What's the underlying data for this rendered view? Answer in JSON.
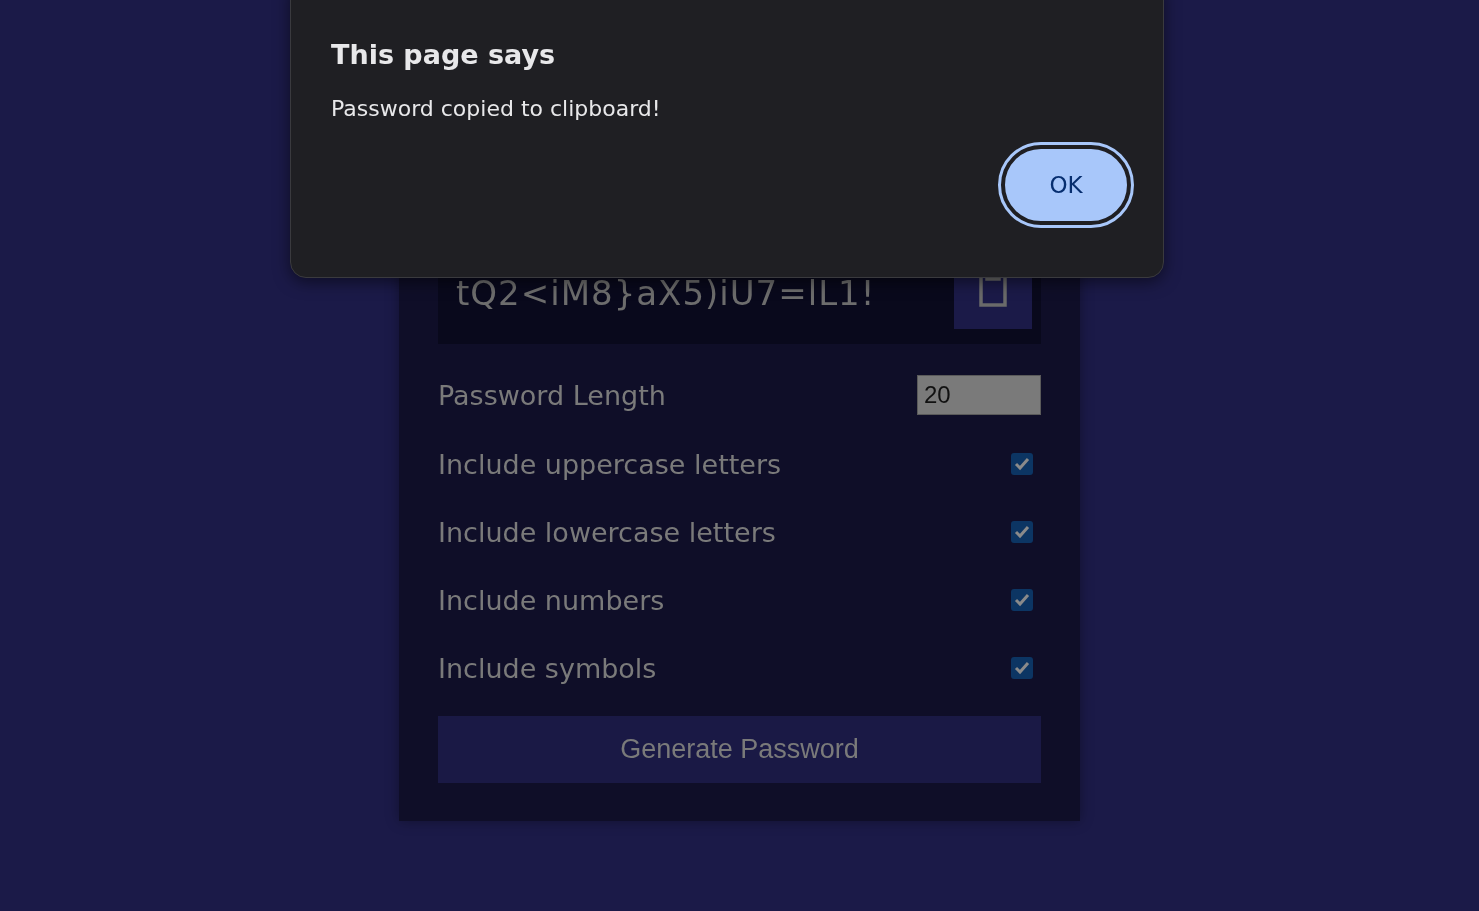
{
  "dialog": {
    "title": "This page says",
    "message": "Password copied to clipboard!",
    "button": "OK"
  },
  "generator": {
    "password": "tQ2<iM8}aX5)iU7=lL1!",
    "length_label": "Password Length",
    "length_value": "20",
    "options": [
      {
        "label": "Include uppercase letters",
        "checked": true
      },
      {
        "label": "Include lowercase letters",
        "checked": true
      },
      {
        "label": "Include numbers",
        "checked": true
      },
      {
        "label": "Include symbols",
        "checked": true
      }
    ],
    "generate_button": "Generate Password"
  }
}
